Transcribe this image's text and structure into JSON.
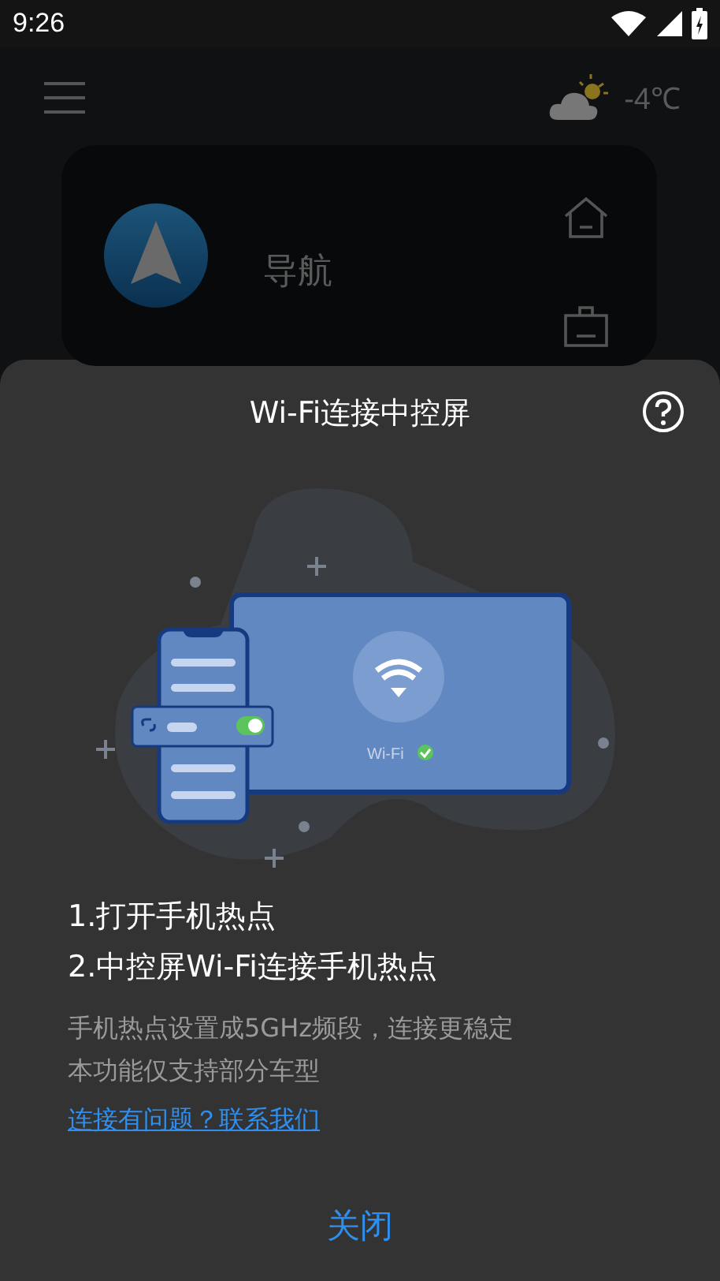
{
  "status_bar": {
    "time": "9:26"
  },
  "home": {
    "temperature": "-4℃",
    "nav_card": {
      "label": "导航"
    }
  },
  "dialog": {
    "title": "Wi-Fi连接中控屏",
    "illustration": {
      "label": "Wi-Fi"
    },
    "steps": [
      "1.打开手机热点",
      "2.中控屏Wi-Fi连接手机热点"
    ],
    "notes": [
      "手机热点设置成5GHz频段，连接更稳定",
      "本功能仅支持部分车型"
    ],
    "help_link": "连接有问题？联系我们",
    "close_button": "关闭"
  }
}
